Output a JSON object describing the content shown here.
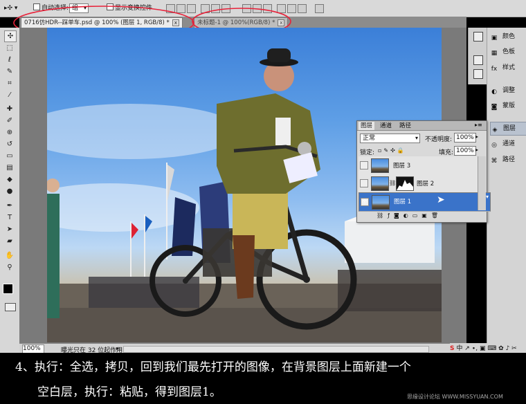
{
  "options_bar": {
    "auto_select_label": "自动选择:",
    "auto_select_value": "组",
    "show_transform_label": "显示变换控件"
  },
  "tabs": [
    {
      "label": "0716仿HDR--踩单车.psd @ 100% (图层 1, RGB/8) *",
      "close": "x"
    },
    {
      "label": "未标题-1 @ 100%(RGB/8) *",
      "close": "x"
    }
  ],
  "tools": [
    "move",
    "marquee",
    "lasso",
    "quick-select",
    "crop",
    "eyedropper",
    "healing",
    "brush",
    "clone",
    "history-brush",
    "eraser",
    "gradient",
    "blur",
    "dodge",
    "pen",
    "type",
    "path-select",
    "shape",
    "hand",
    "zoom"
  ],
  "panels": [
    {
      "label": "颜色",
      "icon": "palette-icon",
      "glyph": "▣"
    },
    {
      "label": "色板",
      "icon": "swatches-icon",
      "glyph": "▦"
    },
    {
      "label": "样式",
      "icon": "styles-icon",
      "glyph": "fx"
    },
    {
      "label": "调整",
      "icon": "adjustments-icon",
      "glyph": "◐"
    },
    {
      "label": "蒙版",
      "icon": "masks-icon",
      "glyph": "◙"
    },
    {
      "label": "图层",
      "icon": "layers-icon",
      "glyph": "◈"
    },
    {
      "label": "通道",
      "icon": "channels-icon",
      "glyph": "◎"
    },
    {
      "label": "路径",
      "icon": "paths-icon",
      "glyph": "⌘"
    }
  ],
  "layers_panel": {
    "tabs": [
      "图层",
      "通道",
      "路径"
    ],
    "blend_mode": "正常",
    "opacity_label": "不透明度:",
    "opacity_value": "100%",
    "lock_label": "锁定:",
    "fill_label": "填充:",
    "fill_value": "100%",
    "layers": [
      {
        "name": "图层 3",
        "selected": false
      },
      {
        "name": "图层 2",
        "selected": false
      },
      {
        "name": "图层 1",
        "selected": true
      }
    ]
  },
  "status_bar": {
    "zoom": "100%",
    "info": "曝光只在 32 位起作用"
  },
  "caption": {
    "line1": "4、执行：全选，拷贝，回到我们最先打开的图像，在背景图层上面新建一个",
    "line2": "空白层，执行：粘贴，得到图层1。"
  },
  "watermark": "思缘设计论坛 WWW.MISSYUAN.COM",
  "colors": {
    "highlight_ring": "#e8223a",
    "selected_layer": "#3a73c9"
  }
}
